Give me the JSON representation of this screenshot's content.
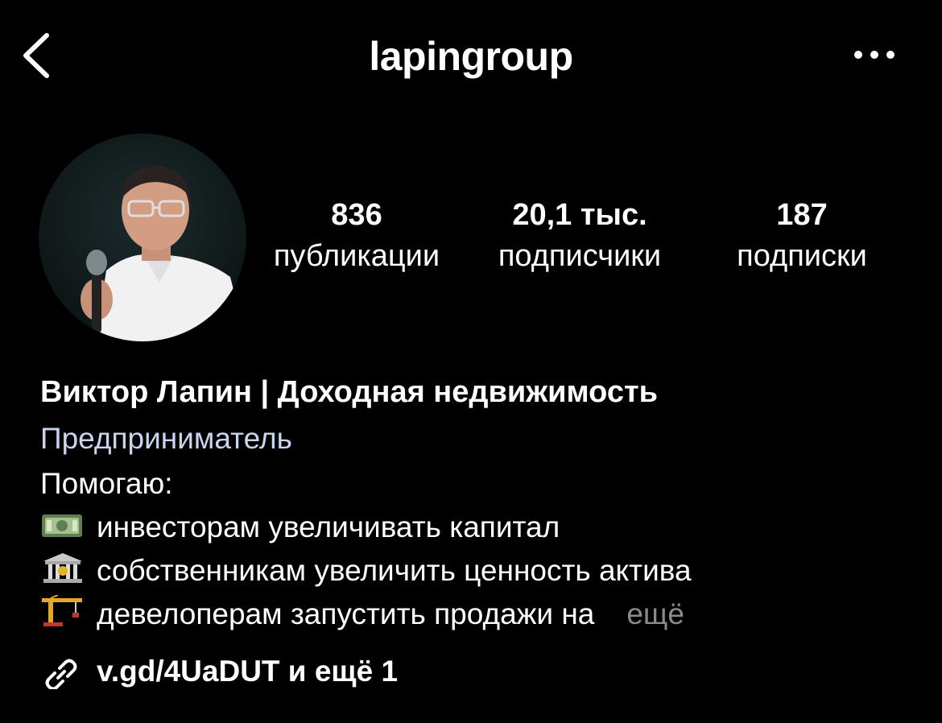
{
  "header": {
    "back_icon": "chevron-left-icon",
    "username": "lapingroup",
    "more_icon": "more-horizontal-icon"
  },
  "profile": {
    "avatar_icon": "profile-photo",
    "stats": [
      {
        "value": "836",
        "label": "публикации"
      },
      {
        "value": "20,1 тыс.",
        "label": "подписчики"
      },
      {
        "value": "187",
        "label": "подписки"
      }
    ]
  },
  "bio": {
    "name": "Виктор Лапин | Доходная недвижимость",
    "category": "Предприниматель",
    "intro": "Помогаю:",
    "lines": [
      {
        "emoji": "money-bill-icon",
        "text": "инвесторам увеличивать капитал"
      },
      {
        "emoji": "bank-building-icon",
        "text": "собственникам увеличить ценность актива"
      },
      {
        "emoji": "construction-crane-icon",
        "text": "девелоперам запустить продажи на"
      }
    ],
    "more_label": "ещё"
  },
  "links": {
    "icon": "link-icon",
    "text": "v.gd/4UaDUT и ещё 1"
  },
  "colors": {
    "background": "#000000",
    "text": "#ffffff",
    "category": "#c9d4ee",
    "muted": "#8a8a8a"
  }
}
